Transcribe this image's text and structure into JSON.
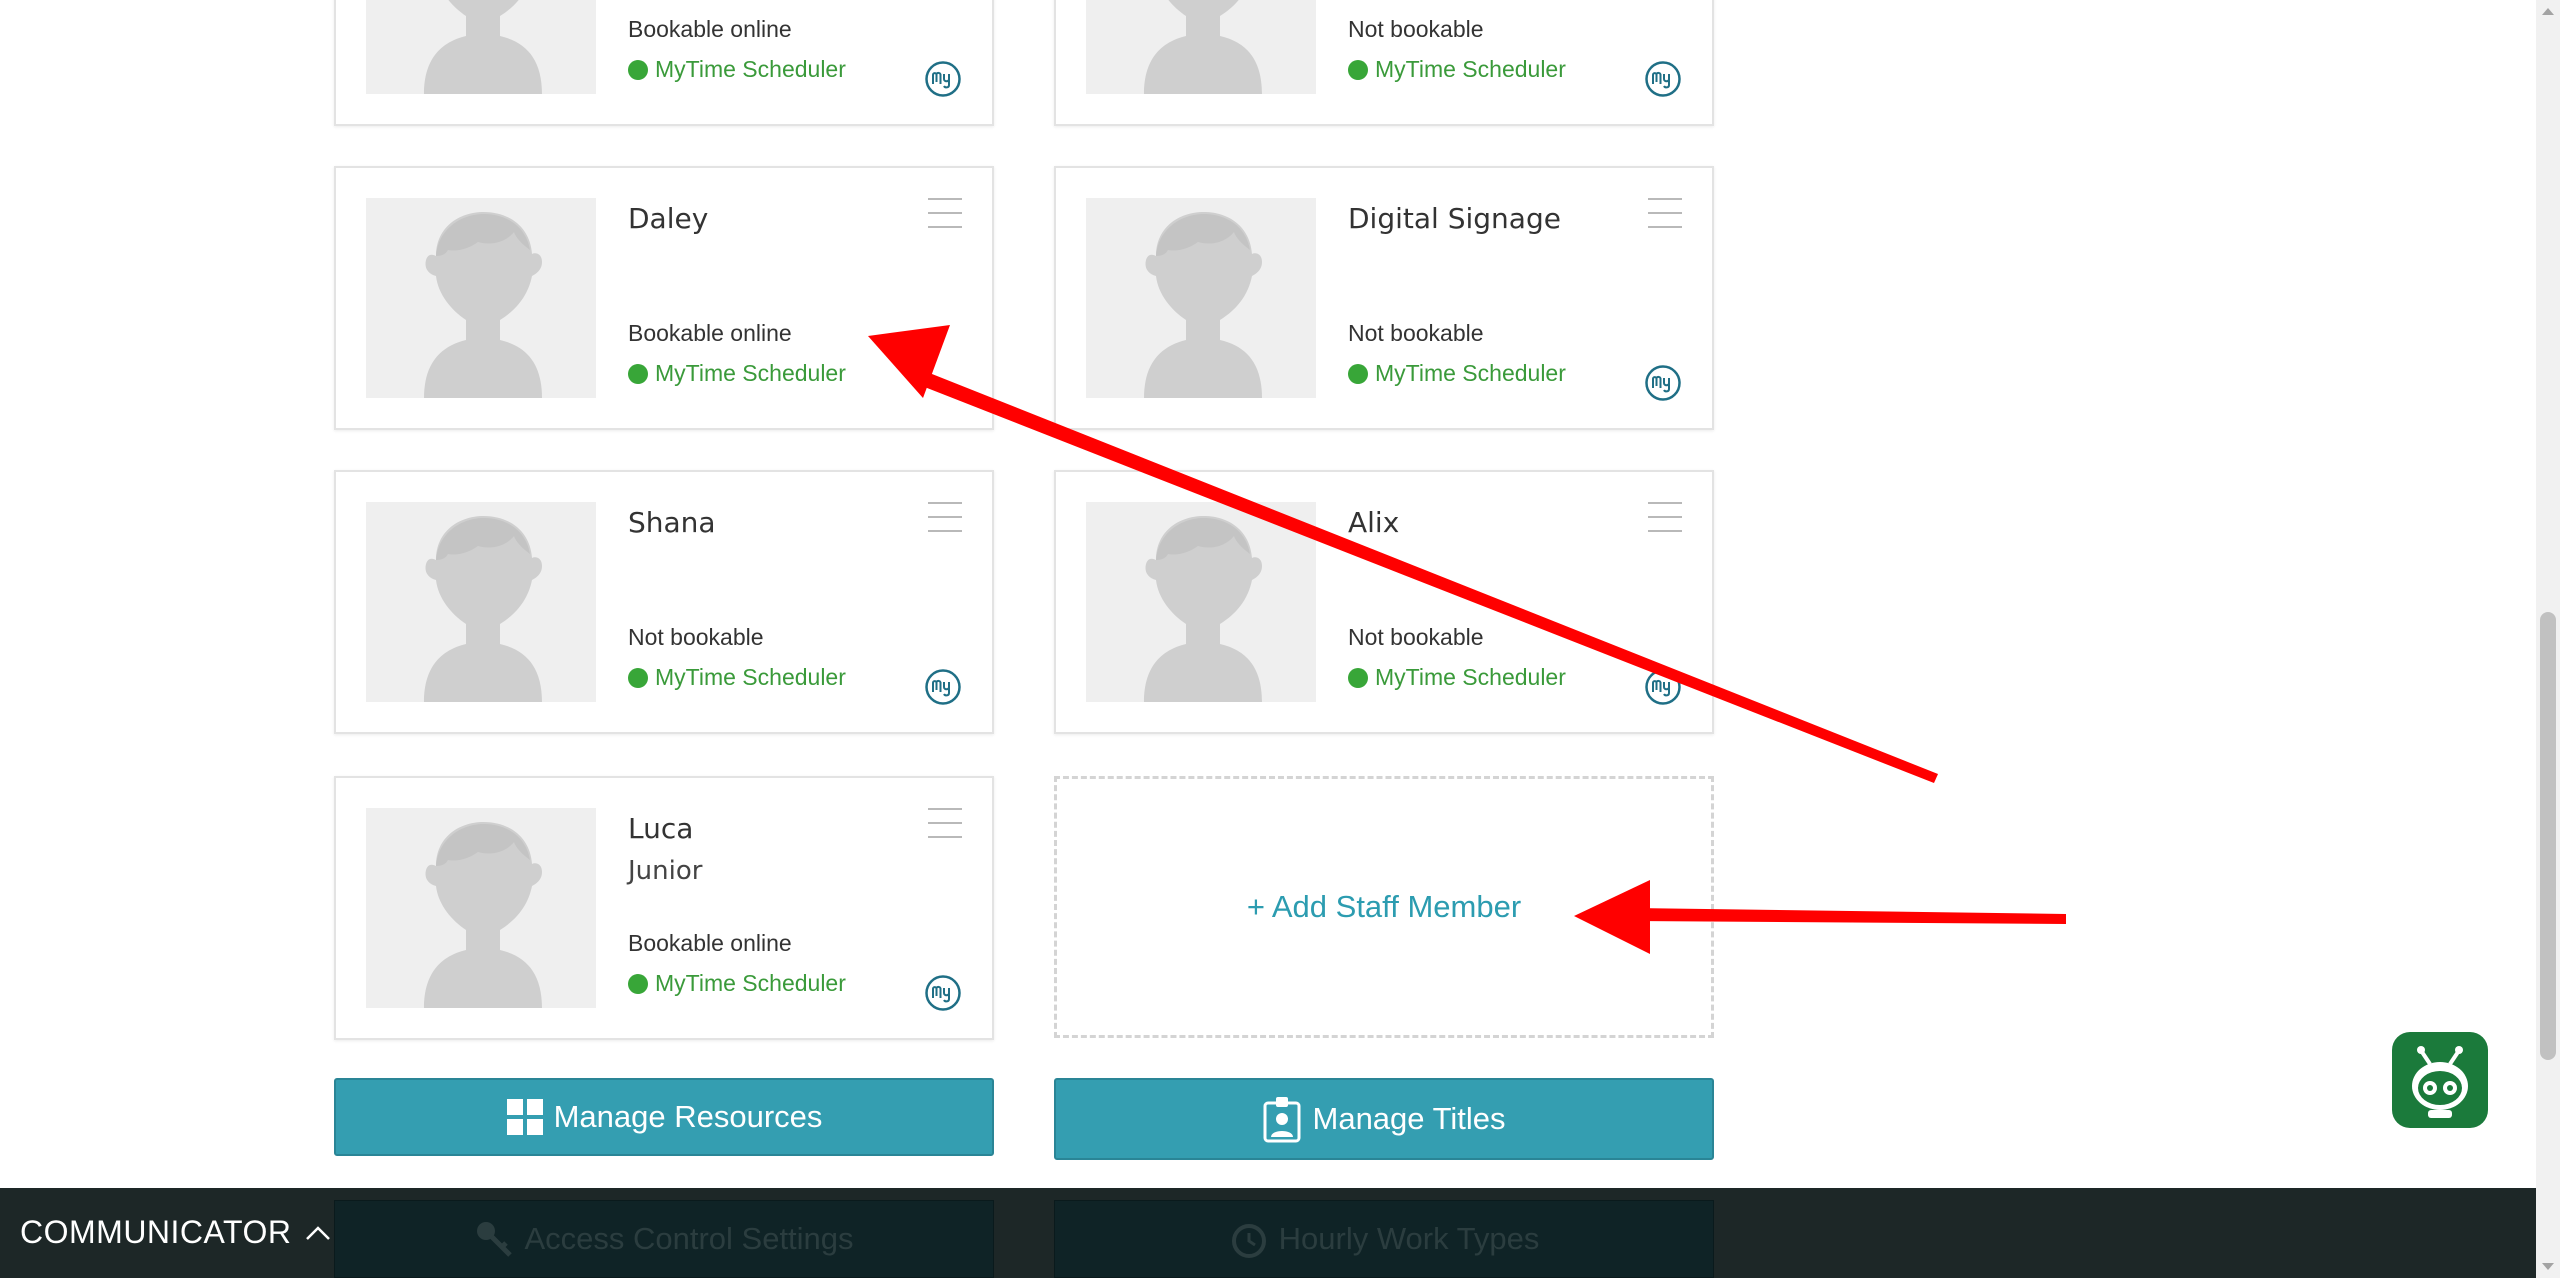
{
  "staff": [
    {
      "name": "",
      "title": "",
      "status": "Bookable online",
      "scheduler": "MyTime Scheduler"
    },
    {
      "name": "",
      "title": "",
      "status": "Not bookable",
      "scheduler": "MyTime Scheduler"
    },
    {
      "name": "Daley",
      "title": "",
      "status": "Bookable online",
      "scheduler": "MyTime Scheduler"
    },
    {
      "name": "Digital Signage",
      "title": "",
      "status": "Not bookable",
      "scheduler": "MyTime Scheduler"
    },
    {
      "name": "Shana",
      "title": "",
      "status": "Not bookable",
      "scheduler": "MyTime Scheduler"
    },
    {
      "name": "Alix",
      "title": "",
      "status": "Not bookable",
      "scheduler": "MyTime Scheduler"
    },
    {
      "name": "Luca",
      "title": "Junior",
      "status": "Bookable online",
      "scheduler": "MyTime Scheduler"
    }
  ],
  "add_staff_label": "+ Add Staff Member",
  "buttons": {
    "manage_resources": "Manage Resources",
    "manage_titles": "Manage Titles",
    "access_control": "Access Control Settings",
    "hourly_work_types": "Hourly Work Types"
  },
  "communicator": {
    "label": "COMMUNICATOR"
  },
  "colors": {
    "accent": "#349eb1",
    "scheduler_green": "#38a638",
    "annotation_red": "#ff0000",
    "bottom_bar": "#1d2727",
    "bot_green": "#1b7a3b"
  },
  "icons": {
    "menu": "hamburger-icon",
    "scheduler_logo": "mytime-logo-icon",
    "resources": "grid-icon",
    "titles": "id-badge-icon",
    "access": "key-icon",
    "hourly": "clock-icon",
    "communicator_toggle": "chevron-up-icon",
    "assistant": "robot-icon"
  }
}
